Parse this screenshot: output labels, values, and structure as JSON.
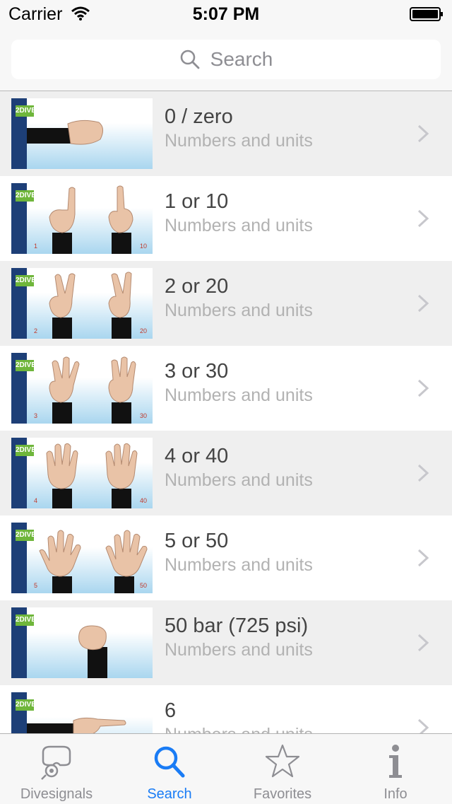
{
  "status_bar": {
    "carrier": "Carrier",
    "time": "5:07 PM"
  },
  "search": {
    "placeholder": "Search"
  },
  "list": [
    {
      "title": "0 / zero",
      "subtitle": "Numbers and units",
      "thumb_left": "",
      "thumb_right": ""
    },
    {
      "title": "1 or 10",
      "subtitle": "Numbers and units",
      "thumb_left": "1",
      "thumb_right": "10"
    },
    {
      "title": "2 or 20",
      "subtitle": "Numbers and units",
      "thumb_left": "2",
      "thumb_right": "20"
    },
    {
      "title": "3 or 30",
      "subtitle": "Numbers and units",
      "thumb_left": "3",
      "thumb_right": "30"
    },
    {
      "title": "4 or 40",
      "subtitle": "Numbers and units",
      "thumb_left": "4",
      "thumb_right": "40"
    },
    {
      "title": "5 or 50",
      "subtitle": "Numbers and units",
      "thumb_left": "5",
      "thumb_right": "50"
    },
    {
      "title": "50 bar (725 psi)",
      "subtitle": "Numbers and units",
      "thumb_left": "",
      "thumb_right": ""
    },
    {
      "title": "6",
      "subtitle": "Numbers and units",
      "thumb_left": "",
      "thumb_right": ""
    }
  ],
  "tabs": [
    {
      "label": "Divesignals",
      "icon": "diving-mask-icon",
      "active": false
    },
    {
      "label": "Search",
      "icon": "search-icon",
      "active": true
    },
    {
      "label": "Favorites",
      "icon": "star-icon",
      "active": false
    },
    {
      "label": "Info",
      "icon": "info-icon",
      "active": false
    }
  ],
  "colors": {
    "accent": "#1a7cf5",
    "row_alt": "#efefef",
    "subtitle": "#b2b2b2",
    "thumb_band": "#1d3f77",
    "logo": "#6fb63b"
  }
}
